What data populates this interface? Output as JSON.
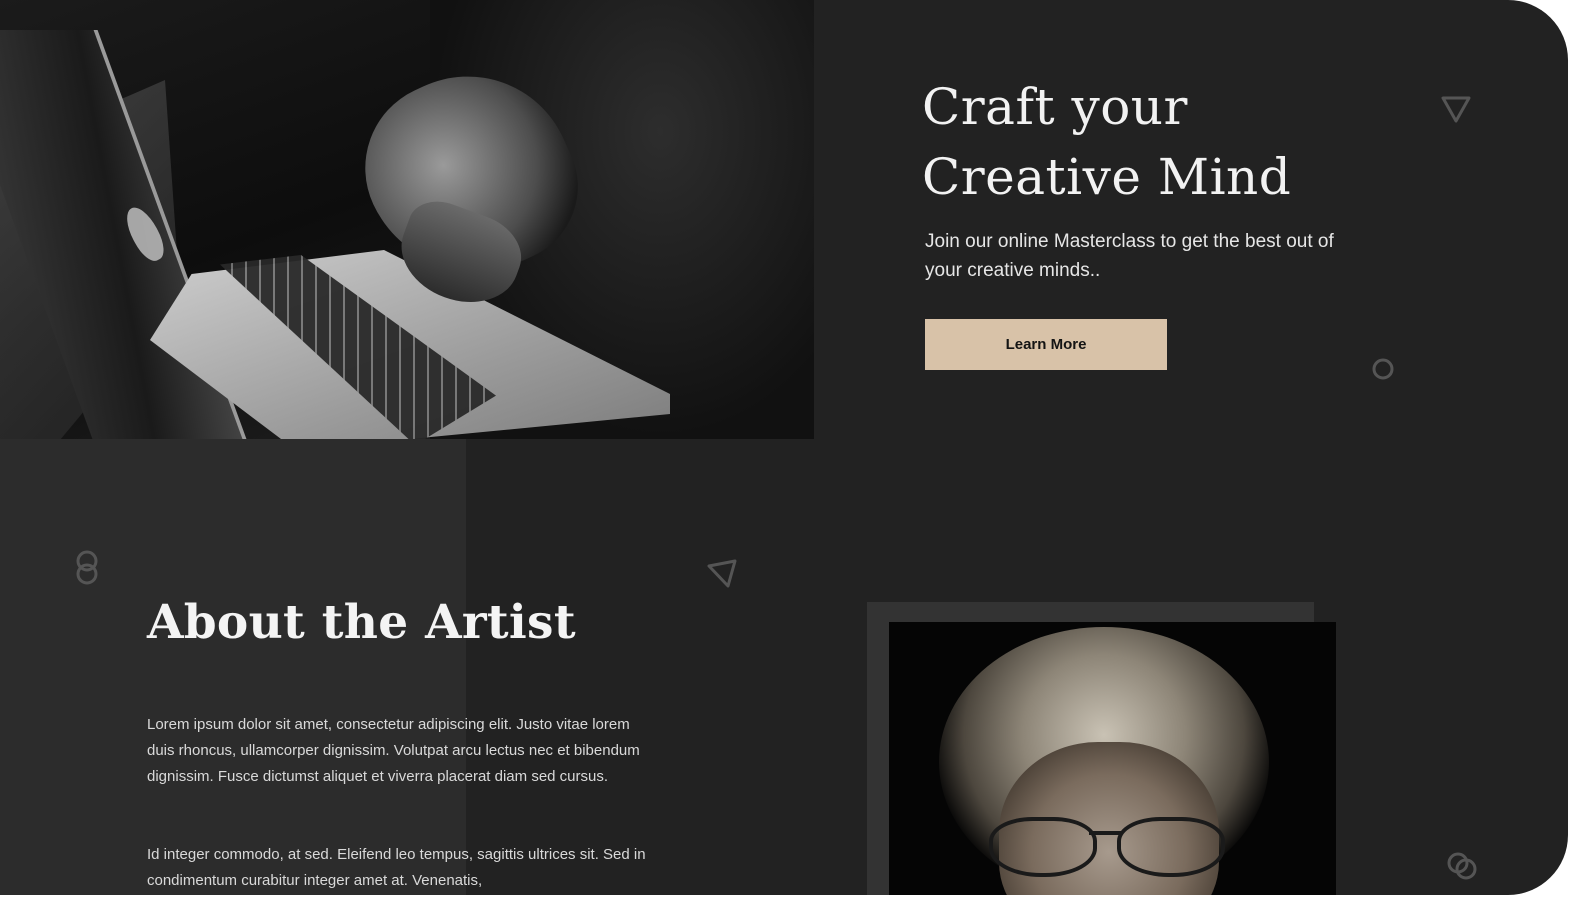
{
  "hero": {
    "title_line1": "Craft your",
    "title_line2": "Creative Mind",
    "subtitle": "Join our online Masterclass to get the best out of your creative minds..",
    "cta_label": "Learn More"
  },
  "about": {
    "title": "About the Artist",
    "paragraph1": "Lorem ipsum dolor sit amet, consectetur adipiscing elit. Justo vitae lorem duis rhoncus, ullamcorper dignissim. Volutpat arcu lectus nec et bibendum dignissim. Fusce dictumst aliquet et viverra placerat diam sed cursus.",
    "paragraph2": "Id integer commodo, at sed. Eleifend leo tempus, sagittis ultrices sit. Sed in condimentum curabitur integer amet at. Venenatis,"
  },
  "images": {
    "hero": "laptop-hands-photo",
    "portrait": "artist-portrait-photo"
  },
  "decorations": [
    "triangle-outline-icon",
    "circle-outline-icon",
    "linked-rings-icon",
    "triangle-outline-icon",
    "linked-rings-icon"
  ],
  "colors": {
    "background": "#222222",
    "panel": "#2c2c2c",
    "accent": "#d8c2a8",
    "text": "#f2f2f2",
    "deco": "#555555"
  }
}
